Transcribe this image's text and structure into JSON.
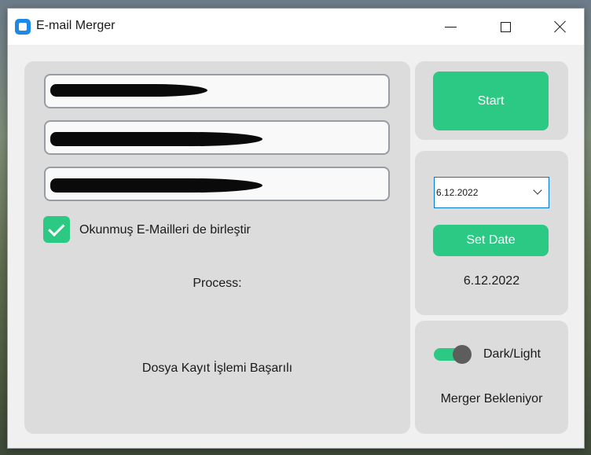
{
  "window": {
    "title": "E-mail Merger",
    "icon": "app-icon"
  },
  "main": {
    "fields": [
      {
        "value": "",
        "redacted": true
      },
      {
        "value": "",
        "redacted": true
      },
      {
        "value": "",
        "redacted": true
      }
    ],
    "checkbox": {
      "label": "Okunmuş E-Mailleri de birleştir",
      "checked": true
    },
    "process_label": "Process:",
    "status_message": "Dosya Kayıt İşlemi Başarılı"
  },
  "side": {
    "start_label": "Start",
    "date_select_value": "6.12.2022",
    "set_date_label": "Set Date",
    "date_display": "6.12.2022",
    "switch_label": "Dark/Light",
    "switch_on": true,
    "merger_status": "Merger Bekleniyor"
  },
  "colors": {
    "accent": "#2cc985",
    "panel": "#dcdcdc",
    "window": "#f0f0f0"
  }
}
